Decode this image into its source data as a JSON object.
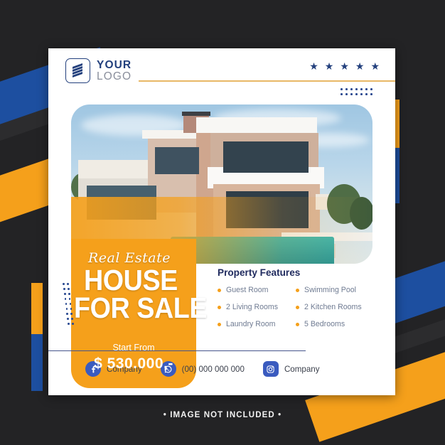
{
  "caption": "•  IMAGE NOT INCLUDED  •",
  "header": {
    "logo": {
      "icon": "stripes-logo-icon",
      "line1": "YOUR",
      "line2": "LOGO"
    },
    "stars": [
      "★",
      "★",
      "★",
      "★",
      "★"
    ],
    "star_count": 5
  },
  "hero": {
    "alt": "modern-villa-with-pool-photo",
    "script_label": "Real Estate",
    "headline_line1": "HOUSE",
    "headline_line2": "FOR SALE"
  },
  "price": {
    "start_label": "Start From",
    "amount": "$ 530.000,-"
  },
  "features": {
    "title": "Property Features",
    "items": [
      "Guest Room",
      "Swimming Pool",
      "2 Living Rooms",
      "2 Kitchen Rooms",
      "Laundry Room",
      "5 Bedrooms"
    ]
  },
  "footer": {
    "contacts": [
      {
        "icon": "facebook-icon",
        "glyph": "f",
        "label": "Company"
      },
      {
        "icon": "whatsapp-icon",
        "glyph": "✆",
        "label": "(00) 000 000 000"
      },
      {
        "icon": "instagram-icon",
        "glyph": "◉",
        "label": "Company"
      }
    ]
  },
  "colors": {
    "orange": "#F5A01B",
    "blue": "#1D4FA0",
    "navy": "#1F2A5E",
    "dark_bg": "#232325",
    "card_bg": "#FFFFFF",
    "muted_text": "#6F7B92"
  }
}
